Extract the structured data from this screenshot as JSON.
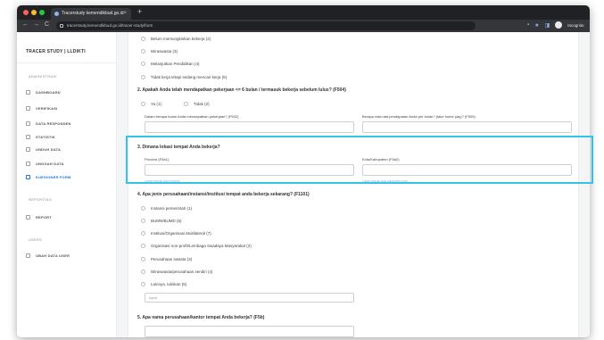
{
  "browser": {
    "tab_title": "Tracerstudy kemendikbud.go.id",
    "tab_close": "×",
    "new_tab": "+",
    "url": "tracerstudy.kemendikbud.go.id/tracer-study/form",
    "nav_back": "←",
    "nav_forward": "→",
    "nav_reload": "C",
    "ext_cast": "▪",
    "ext_star": "★",
    "ext_puzzle": "◨",
    "incognito_label": "Incognito",
    "kebab": "⋮",
    "dot_colors": [
      "#ff5f57",
      "#febc2e",
      "#28c840"
    ]
  },
  "sidebar": {
    "brand": "TRACER STUDY | LLDIKTI",
    "section_main": "ADMINISTRASI",
    "section_report": "REPORTING",
    "section_users": "USERS",
    "items": [
      {
        "label": "DASHBOARD"
      },
      {
        "label": "VERIFIKASI"
      },
      {
        "label": "DATA RESPONDEN"
      },
      {
        "label": "STATISTIK"
      },
      {
        "label": "UNDUH DATA"
      },
      {
        "label": "UNGGAH DATA"
      },
      {
        "label": "KUESIONER FORM"
      },
      {
        "label": "REPORT"
      },
      {
        "label": "UBAH DATA USER"
      }
    ],
    "accent": "#1976d2"
  },
  "form": {
    "top_options": [
      "Belum memungkinkan bekerja (2)",
      "Wiraswasta (3)",
      "Melanjutkan Pendidikan (4)",
      "Tidak kerja tetapi sedang mencari kerja (5)"
    ],
    "q2": {
      "title": "2. Apakah Anda telah mendapatkan pekerjaan <= 6 bulan / termasuk bekerja sebelum lulus? (F504)",
      "option_yes": "Ya (1)",
      "option_no": "Tidak (2)",
      "field_months": "Dalam berapa bulan Anda mendapatkan pekerjaan? (F502)",
      "field_salary": "Berapa rata-rata pendapatan Anda per bulan? (take home pay)? (F505)"
    },
    "q3": {
      "title": "3. Dimana lokasi tempat Anda bekerja?",
      "field_province": "Provinsi (F5a1)",
      "hint_province": "Lokasi sesuai kota provinsi",
      "field_city": "Kota/Kabupaten (F5a2)",
      "hint_city": "Lokasi sesuai kota kabupaten kota"
    },
    "q4": {
      "title": "4. Apa jenis perusahaan/instansi/institusi tempat anda bekerja sekarang? (F1101)",
      "options": [
        "Instansi pemerintah (1)",
        "BUMN/BUMD (6)",
        "Institusi/Organisasi Multilateral (7)",
        "Organisasi non-profit/Lembaga Swadaya Masyarakat (2)",
        "Perusahaan swasta (3)",
        "Wiraswasta/perusahaan sendiri (4)",
        "Lainnya, tuliskan (5)"
      ],
      "other_placeholder": "Input"
    },
    "q5": {
      "title": "5. Apa nama perusahaan/kantor tempat Anda bekerja? (F5b)"
    },
    "highlight_color": "#34c3e8"
  }
}
